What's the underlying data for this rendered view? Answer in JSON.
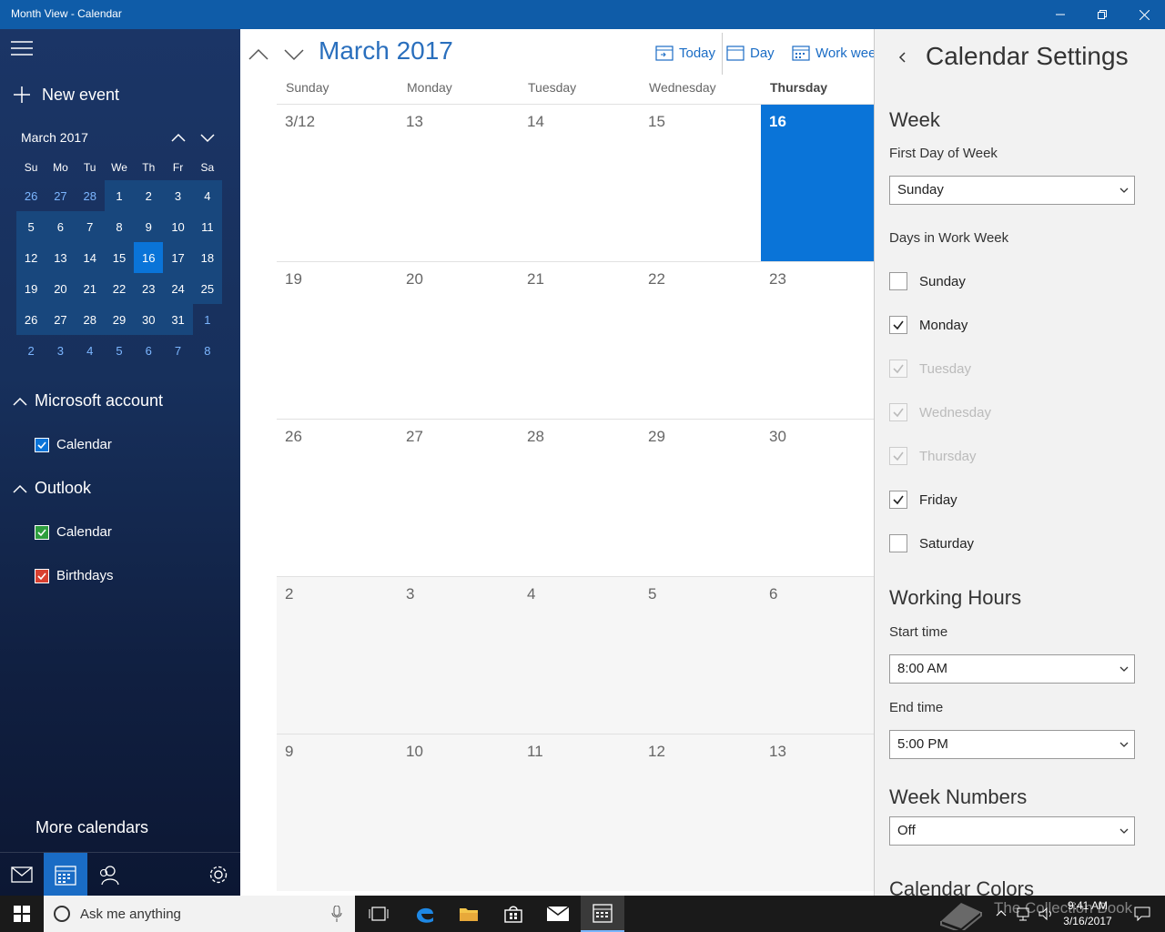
{
  "window": {
    "title": "Month View - Calendar"
  },
  "sidebar": {
    "new_event_label": "New event",
    "mini_calendar": {
      "title": "March 2017",
      "weekdays": [
        "Su",
        "Mo",
        "Tu",
        "We",
        "Th",
        "Fr",
        "Sa"
      ],
      "weeks": [
        [
          "26",
          "27",
          "28",
          "1",
          "2",
          "3",
          "4"
        ],
        [
          "5",
          "6",
          "7",
          "8",
          "9",
          "10",
          "11"
        ],
        [
          "12",
          "13",
          "14",
          "15",
          "16",
          "17",
          "18"
        ],
        [
          "19",
          "20",
          "21",
          "22",
          "23",
          "24",
          "25"
        ],
        [
          "26",
          "27",
          "28",
          "29",
          "30",
          "31",
          "1"
        ],
        [
          "2",
          "3",
          "4",
          "5",
          "6",
          "7",
          "8"
        ]
      ],
      "selected_day": "16"
    },
    "accounts": [
      {
        "name": "Microsoft account",
        "calendars": [
          {
            "label": "Calendar",
            "color": "#0a74d8"
          }
        ]
      },
      {
        "name": "Outlook",
        "calendars": [
          {
            "label": "Calendar",
            "color": "#2e9e3e"
          },
          {
            "label": "Birthdays",
            "color": "#d84030"
          }
        ]
      }
    ],
    "more_calendars_label": "More calendars"
  },
  "main": {
    "month_title": "March 2017",
    "view_buttons": {
      "today": "Today",
      "day": "Day",
      "work_week": "Work week"
    },
    "day_headers": [
      "Sunday",
      "Monday",
      "Tuesday",
      "Wednesday",
      "Thursday"
    ],
    "weeks": [
      [
        "3/12",
        "13",
        "14",
        "15",
        "16"
      ],
      [
        "19",
        "20",
        "21",
        "22",
        "23"
      ],
      [
        "26",
        "27",
        "28",
        "29",
        "30"
      ],
      [
        "2",
        "3",
        "4",
        "5",
        "6"
      ],
      [
        "9",
        "10",
        "11",
        "12",
        "13"
      ]
    ],
    "today_label": "16"
  },
  "settings": {
    "title": "Calendar Settings",
    "week_heading": "Week",
    "first_day_label": "First Day of Week",
    "first_day_value": "Sunday",
    "work_week_label": "Days in Work Week",
    "work_days": [
      {
        "label": "Sunday",
        "checked": false,
        "disabled": false
      },
      {
        "label": "Monday",
        "checked": true,
        "disabled": false
      },
      {
        "label": "Tuesday",
        "checked": true,
        "disabled": true
      },
      {
        "label": "Wednesday",
        "checked": true,
        "disabled": true
      },
      {
        "label": "Thursday",
        "checked": true,
        "disabled": true
      },
      {
        "label": "Friday",
        "checked": true,
        "disabled": false
      },
      {
        "label": "Saturday",
        "checked": false,
        "disabled": false
      }
    ],
    "working_hours_heading": "Working Hours",
    "start_time_label": "Start time",
    "start_time_value": "8:00 AM",
    "end_time_label": "End time",
    "end_time_value": "5:00 PM",
    "week_numbers_heading": "Week Numbers",
    "week_numbers_value": "Off",
    "calendar_colors_heading": "Calendar Colors"
  },
  "taskbar": {
    "search_placeholder": "Ask me anything",
    "time": "9:41 AM",
    "date": "3/16/2017",
    "watermark": "The Collection Book"
  },
  "colors": {
    "accent": "#0a74d8",
    "titlebar": "#0f5ca8"
  }
}
